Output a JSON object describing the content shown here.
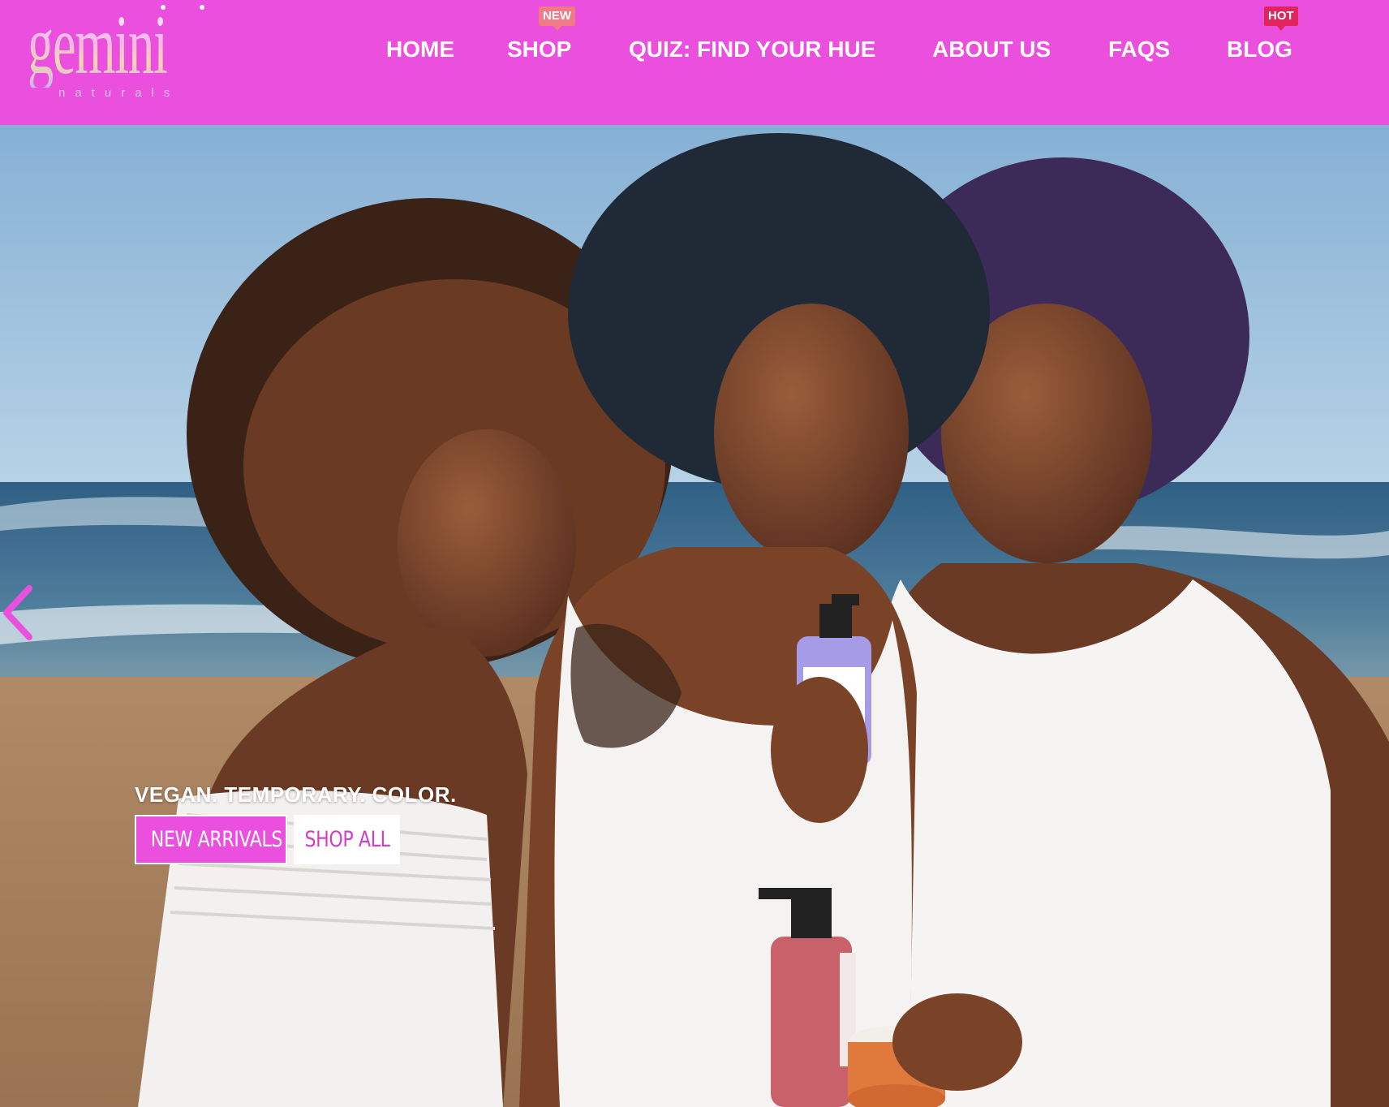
{
  "brand": {
    "logo_text": "gemini",
    "logo_sub": "naturals",
    "colors": {
      "primary": "#eb4fde",
      "badge_new": "#f07a86",
      "badge_hot": "#e0245e",
      "text_on_primary": "#ffffff"
    }
  },
  "nav": {
    "items": [
      {
        "label": "HOME"
      },
      {
        "label": "SHOP",
        "badge": "NEW"
      },
      {
        "label": "QUIZ: FIND YOUR HUE"
      },
      {
        "label": "ABOUT US"
      },
      {
        "label": "FAQS"
      },
      {
        "label": "BLOG",
        "badge": "HOT"
      }
    ]
  },
  "hero": {
    "tagline": "VEGAN. TEMPORARY. COLOR.",
    "buttons": {
      "primary": "NEW ARRIVALS",
      "secondary": "SHOP ALL"
    },
    "prev_icon": "chevron-left-icon"
  }
}
